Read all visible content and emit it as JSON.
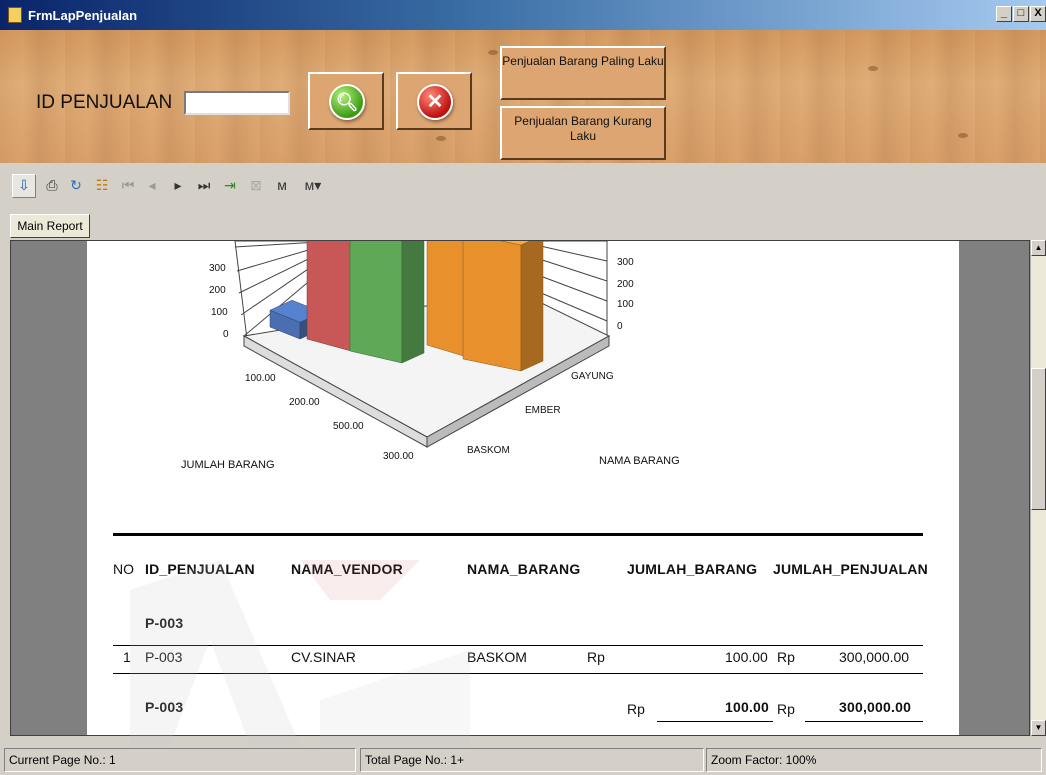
{
  "window": {
    "title": "FrmLapPenjualan",
    "minimize": "_",
    "maximize": "□",
    "close": "X"
  },
  "form": {
    "id_label": "ID PENJUALAN",
    "id_value": "",
    "btn_best_selling": "Penjualan Barang Paling Laku",
    "btn_least_selling": "Penjualan Barang Kurang Laku"
  },
  "tabs": {
    "main_report": "Main Report"
  },
  "chart": {
    "left_ticks": [
      "300",
      "200",
      "100",
      "0"
    ],
    "right_ticks": [
      "300",
      "200",
      "100",
      "0"
    ],
    "x_ticks": [
      "100.00",
      "200.00",
      "500.00",
      "300.00"
    ],
    "depth_ticks": [
      "GAYUNG",
      "EMBER",
      "BASKOM"
    ],
    "xlabel": "JUMLAH BARANG",
    "zlabel": "NAMA BARANG"
  },
  "chart_data": {
    "type": "bar",
    "categories": [
      "BASKOM",
      "EMBER",
      "GAYUNG"
    ],
    "series": [
      {
        "name": "100.00",
        "values": [
          40,
          0,
          0
        ]
      },
      {
        "name": "200.00",
        "values": [
          320,
          0,
          0
        ]
      },
      {
        "name": "500.00",
        "values": [
          300,
          0,
          0
        ]
      },
      {
        "name": "300.00",
        "values": [
          0,
          500,
          300
        ]
      }
    ],
    "xlabel": "JUMLAH BARANG",
    "zlabel": "NAMA BARANG",
    "colors": [
      "#4a6eb0",
      "#c85858",
      "#5fa858",
      "#e8902c"
    ]
  },
  "table": {
    "headers": {
      "no": "NO",
      "id": "ID_PENJUALAN",
      "vendor": "NAMA_VENDOR",
      "barang": "NAMA_BARANG",
      "jumlah_barang": "JUMLAH_BARANG",
      "jumlah_penjualan": "JUMLAH_PENJUALAN"
    },
    "group_header": "P-003",
    "row": {
      "no": "1",
      "id": "P-003",
      "vendor": "CV.SINAR",
      "barang": "BASKOM",
      "rp1": "Rp",
      "jumlah_barang": "100.00",
      "rp2": "Rp",
      "jumlah_penjualan": "300,000.00"
    },
    "subtotal": {
      "id": "P-003",
      "rp1": "Rp",
      "jumlah_barang": "100.00",
      "rp2": "Rp",
      "jumlah_penjualan": "300,000.00"
    }
  },
  "status": {
    "current_page": "Current Page No.: 1",
    "total_page": "Total Page No.: 1+",
    "zoom": "Zoom Factor: 100%"
  }
}
